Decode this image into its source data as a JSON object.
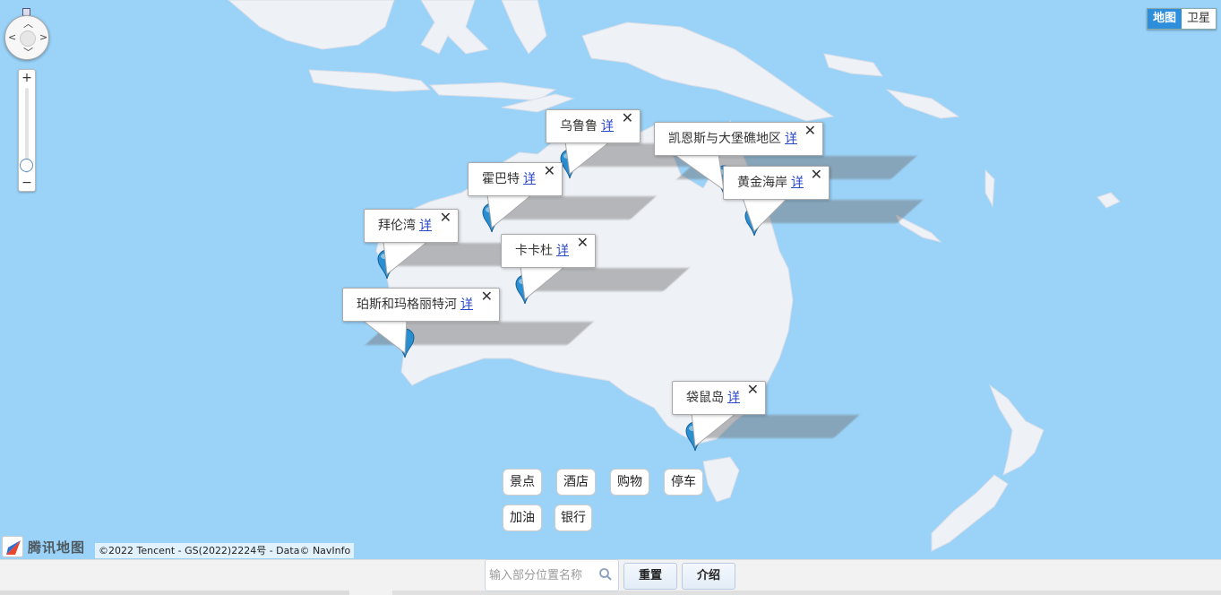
{
  "map_type": {
    "map_label": "地图",
    "satellite_label": "卫星",
    "active": "map"
  },
  "info_windows": [
    {
      "name": "乌鲁鲁",
      "link": "详"
    },
    {
      "name": "凯恩斯与大堡礁地区",
      "link": "详"
    },
    {
      "name": "霍巴特",
      "link": "详"
    },
    {
      "name": "黄金海岸",
      "link": "详"
    },
    {
      "name": "拜伦湾",
      "link": "详"
    },
    {
      "name": "卡卡杜",
      "link": "详"
    },
    {
      "name": "珀斯和玛格丽特河",
      "link": "详"
    },
    {
      "name": "袋鼠岛",
      "link": "详"
    }
  ],
  "close_symbol": "✕",
  "zoom": {
    "plus": "+",
    "minus": "−",
    "level_fraction": 0.1
  },
  "categories": [
    "景点",
    "酒店",
    "购物",
    "停车",
    "加油",
    "银行"
  ],
  "logo_text": "腾讯地图",
  "copyright": "©2022 Tencent - GS(2022)2224号 - Data© NavInfo",
  "search": {
    "placeholder": "输入部分位置名称",
    "value": ""
  },
  "buttons": {
    "reset": "重置",
    "intro": "介绍"
  },
  "colors": {
    "water": "#9ad2f8",
    "land": "#eef1f6",
    "accent": "#2d8fdc",
    "pin": "#2a8fd0",
    "link": "#2846c8"
  },
  "icons": {
    "pan": "pan-control-icon",
    "fullscreen": "fullscreen-icon",
    "pin": "map-pin-icon",
    "close": "close-icon",
    "search": "search-icon",
    "logo": "tencent-maps-logo-icon"
  }
}
